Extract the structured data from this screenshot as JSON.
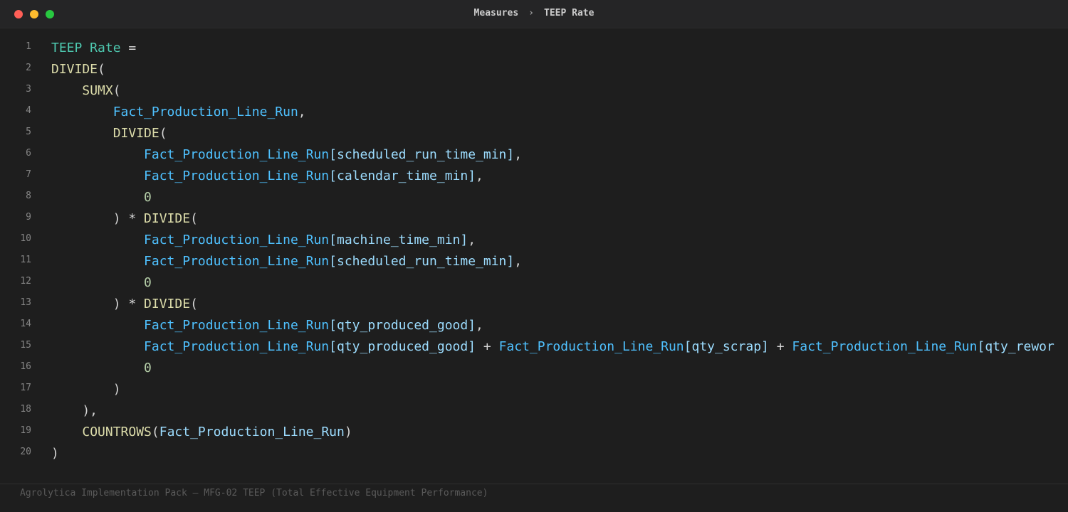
{
  "breadcrumb": {
    "parent": "Measures",
    "separator": "›",
    "current": "TEEP Rate"
  },
  "code_lines": [
    {
      "n": "1",
      "tokens": [
        {
          "t": "TEEP Rate",
          "k": "measure"
        },
        {
          "t": " =",
          "k": "punc"
        }
      ]
    },
    {
      "n": "2",
      "tokens": [
        {
          "t": "DIVIDE",
          "k": "fn"
        },
        {
          "t": "(",
          "k": "punc"
        }
      ]
    },
    {
      "n": "3",
      "tokens": [
        {
          "t": "    ",
          "k": "punc"
        },
        {
          "t": "SUMX",
          "k": "fn"
        },
        {
          "t": "(",
          "k": "punc"
        }
      ]
    },
    {
      "n": "4",
      "tokens": [
        {
          "t": "        ",
          "k": "punc"
        },
        {
          "t": "Fact_Production_Line_Run",
          "k": "table"
        },
        {
          "t": ",",
          "k": "punc"
        }
      ]
    },
    {
      "n": "5",
      "tokens": [
        {
          "t": "        ",
          "k": "punc"
        },
        {
          "t": "DIVIDE",
          "k": "fn"
        },
        {
          "t": "(",
          "k": "punc"
        }
      ]
    },
    {
      "n": "6",
      "tokens": [
        {
          "t": "            ",
          "k": "punc"
        },
        {
          "t": "Fact_Production_Line_Run",
          "k": "table"
        },
        {
          "t": "[scheduled_run_time_min]",
          "k": "col"
        },
        {
          "t": ",",
          "k": "punc"
        }
      ]
    },
    {
      "n": "7",
      "tokens": [
        {
          "t": "            ",
          "k": "punc"
        },
        {
          "t": "Fact_Production_Line_Run",
          "k": "table"
        },
        {
          "t": "[calendar_time_min]",
          "k": "col"
        },
        {
          "t": ",",
          "k": "punc"
        }
      ]
    },
    {
      "n": "8",
      "tokens": [
        {
          "t": "            ",
          "k": "punc"
        },
        {
          "t": "0",
          "k": "num"
        }
      ]
    },
    {
      "n": "9",
      "tokens": [
        {
          "t": "        ) * ",
          "k": "punc"
        },
        {
          "t": "DIVIDE",
          "k": "fn"
        },
        {
          "t": "(",
          "k": "punc"
        }
      ]
    },
    {
      "n": "10",
      "tokens": [
        {
          "t": "            ",
          "k": "punc"
        },
        {
          "t": "Fact_Production_Line_Run",
          "k": "table"
        },
        {
          "t": "[machine_time_min]",
          "k": "col"
        },
        {
          "t": ",",
          "k": "punc"
        }
      ]
    },
    {
      "n": "11",
      "tokens": [
        {
          "t": "            ",
          "k": "punc"
        },
        {
          "t": "Fact_Production_Line_Run",
          "k": "table"
        },
        {
          "t": "[scheduled_run_time_min]",
          "k": "col"
        },
        {
          "t": ",",
          "k": "punc"
        }
      ]
    },
    {
      "n": "12",
      "tokens": [
        {
          "t": "            ",
          "k": "punc"
        },
        {
          "t": "0",
          "k": "num"
        }
      ]
    },
    {
      "n": "13",
      "tokens": [
        {
          "t": "        ) * ",
          "k": "punc"
        },
        {
          "t": "DIVIDE",
          "k": "fn"
        },
        {
          "t": "(",
          "k": "punc"
        }
      ]
    },
    {
      "n": "14",
      "tokens": [
        {
          "t": "            ",
          "k": "punc"
        },
        {
          "t": "Fact_Production_Line_Run",
          "k": "table"
        },
        {
          "t": "[qty_produced_good]",
          "k": "col"
        },
        {
          "t": ",",
          "k": "punc"
        }
      ]
    },
    {
      "n": "15",
      "tokens": [
        {
          "t": "            ",
          "k": "punc"
        },
        {
          "t": "Fact_Production_Line_Run",
          "k": "table"
        },
        {
          "t": "[qty_produced_good]",
          "k": "col"
        },
        {
          "t": " + ",
          "k": "punc"
        },
        {
          "t": "Fact_Production_Line_Run",
          "k": "table"
        },
        {
          "t": "[qty_scrap]",
          "k": "col"
        },
        {
          "t": " + ",
          "k": "punc"
        },
        {
          "t": "Fact_Production_Line_Run",
          "k": "table"
        },
        {
          "t": "[qty_rewor",
          "k": "col"
        }
      ]
    },
    {
      "n": "16",
      "tokens": [
        {
          "t": "            ",
          "k": "punc"
        },
        {
          "t": "0",
          "k": "num"
        }
      ]
    },
    {
      "n": "17",
      "tokens": [
        {
          "t": "        )",
          "k": "punc"
        }
      ]
    },
    {
      "n": "18",
      "tokens": [
        {
          "t": "    ),",
          "k": "punc"
        }
      ]
    },
    {
      "n": "19",
      "tokens": [
        {
          "t": "    ",
          "k": "punc"
        },
        {
          "t": "COUNTROWS",
          "k": "fn"
        },
        {
          "t": "(",
          "k": "punc"
        },
        {
          "t": "Fact_Production_Line_Run",
          "k": "col"
        },
        {
          "t": ")",
          "k": "punc"
        }
      ]
    },
    {
      "n": "20",
      "tokens": [
        {
          "t": ")",
          "k": "punc"
        }
      ]
    }
  ],
  "footer": {
    "text": "Agrolytica Implementation Pack — MFG-02 TEEP (Total Effective Equipment Performance)"
  },
  "colors": {
    "measure": "#4ec9b0",
    "function": "#dcdcaa",
    "table": "#4fc1ff",
    "column": "#9cdcfe",
    "number": "#b5cea8",
    "punctuation": "#d4d4d4"
  }
}
